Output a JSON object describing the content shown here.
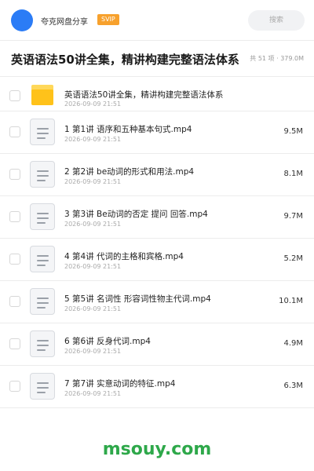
{
  "header": {
    "app_name": "夸克网盘分享",
    "badge": "SVIP",
    "search_placeholder": "搜索",
    "avatar_color": "#2b7cf6",
    "badge_color": "#f7a12d"
  },
  "share": {
    "title": "英语语法50讲全集，精讲构建完整语法体系",
    "summary": "共 51 项 · 379.0M"
  },
  "folder": {
    "name": "英语语法50讲全集，精讲构建完整语法体系",
    "date": "2026-09-09 21:51",
    "icon": "folder-icon"
  },
  "files": [
    {
      "name": "1 第1讲 语序和五种基本句式.mp4",
      "date": "2026-09-09 21:51",
      "size": "9.5M",
      "icon": "file-icon"
    },
    {
      "name": "2 第2讲 be动词的形式和用法.mp4",
      "date": "2026-09-09 21:51",
      "size": "8.1M",
      "icon": "file-icon"
    },
    {
      "name": "3 第3讲 Be动词的否定 提问 回答.mp4",
      "date": "2026-09-09 21:51",
      "size": "9.7M",
      "icon": "file-icon"
    },
    {
      "name": "4 第4讲 代词的主格和宾格.mp4",
      "date": "2026-09-09 21:51",
      "size": "5.2M",
      "icon": "file-icon"
    },
    {
      "name": "5 第5讲 名词性 形容词性物主代词.mp4",
      "date": "2026-09-09 21:51",
      "size": "10.1M",
      "icon": "file-icon"
    },
    {
      "name": "6 第6讲 反身代词.mp4",
      "date": "2026-09-09 21:51",
      "size": "4.9M",
      "icon": "file-icon"
    },
    {
      "name": "7 第7讲 实意动词的特征.mp4",
      "date": "2026-09-09 21:51",
      "size": "6.3M",
      "icon": "file-icon"
    }
  ],
  "watermark": "msouy.com"
}
